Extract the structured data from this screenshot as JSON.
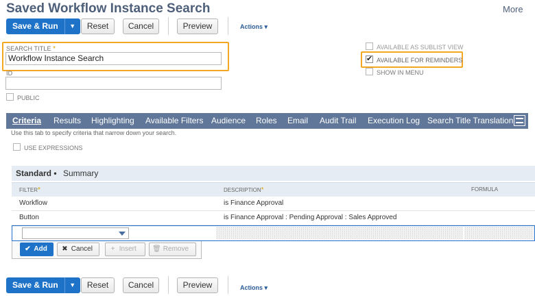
{
  "page": {
    "title": "Saved Workflow Instance Search",
    "more": "More"
  },
  "toolbar": {
    "save_run": "Save & Run",
    "reset": "Reset",
    "cancel": "Cancel",
    "preview": "Preview",
    "actions": "Actions ▾"
  },
  "fields": {
    "search_title": {
      "label": "Search Title",
      "value": "Workflow Instance Search",
      "required": true
    },
    "id": {
      "label": "ID",
      "value": ""
    },
    "public": {
      "label": "Public",
      "checked": false
    }
  },
  "options": [
    {
      "label": "Available as Sublist View",
      "checked": false
    },
    {
      "label": "Available for Reminders",
      "checked": true
    },
    {
      "label": "Show in Menu",
      "checked": false
    }
  ],
  "tabs": [
    "Criteria",
    "Results",
    "Highlighting",
    "Available Filters",
    "Audience",
    "Roles",
    "Email",
    "Audit Trail",
    "Execution Log",
    "Search Title Translation"
  ],
  "criteria": {
    "help": "Use this tab to specify criteria that narrow down your search.",
    "use_expressions": "Use Expressions",
    "subtabs": [
      "Standard •",
      "Summary"
    ],
    "columns": {
      "filter": "Filter",
      "description": "Description",
      "formula": "Formula"
    },
    "rows": [
      {
        "filter": "Workflow",
        "description": "is Finance Approval"
      },
      {
        "filter": "Button",
        "description": "is Finance Approval : Pending Approval : Sales Approved"
      }
    ],
    "row_buttons": {
      "add": "Add",
      "cancel": "Cancel",
      "insert": "Insert",
      "remove": "Remove"
    }
  },
  "colors": {
    "accent": "#1e73c9",
    "tab_bar": "#607799",
    "highlight": "#f5a623",
    "title": "#4d5f79"
  },
  "icons": {
    "add": "check-icon",
    "cancel": "x-icon",
    "insert": "plus-icon",
    "remove": "trash-icon",
    "tab_menu": "hamburger-icon"
  }
}
